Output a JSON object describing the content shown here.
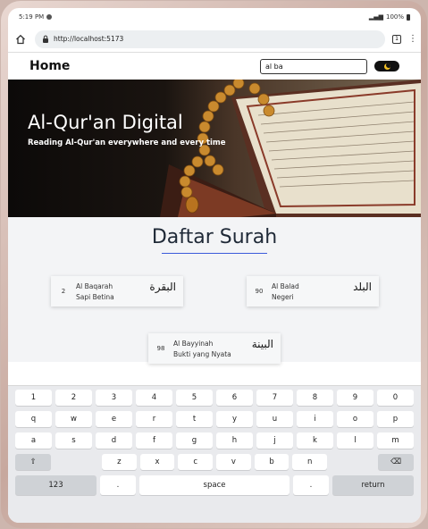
{
  "status_bar": {
    "time": "5:19 PM",
    "battery": "100%"
  },
  "browser": {
    "url": "http://localhost:5173",
    "tab_count": "1"
  },
  "navbar": {
    "title": "Home",
    "search_value": "al ba"
  },
  "hero": {
    "title": "Al-Qur'an Digital",
    "subtitle": "Reading Al-Qur'an everywhere and every time"
  },
  "main": {
    "section_title": "Daftar Surah",
    "surahs": [
      {
        "number": "2",
        "latin": "Al Baqarah",
        "meaning": "Sapi Betina",
        "arabic": "البقرة"
      },
      {
        "number": "90",
        "latin": "Al Balad",
        "meaning": "Negeri",
        "arabic": "البلد"
      },
      {
        "number": "98",
        "latin": "Al Bayyinah",
        "meaning": "Bukti yang Nyata",
        "arabic": "البينة"
      }
    ]
  },
  "keyboard": {
    "row1": [
      "1",
      "2",
      "3",
      "4",
      "5",
      "6",
      "7",
      "8",
      "9",
      "0"
    ],
    "row2": [
      "q",
      "w",
      "e",
      "r",
      "t",
      "y",
      "u",
      "i",
      "o",
      "p"
    ],
    "row3": [
      "a",
      "s",
      "d",
      "f",
      "g",
      "h",
      "j",
      "k",
      "l",
      "m"
    ],
    "row4": [
      "⇧",
      "z",
      "x",
      "c",
      "v",
      "b",
      "n",
      "⌫"
    ],
    "row5": [
      "123",
      ".",
      "space",
      ".",
      "return"
    ]
  }
}
